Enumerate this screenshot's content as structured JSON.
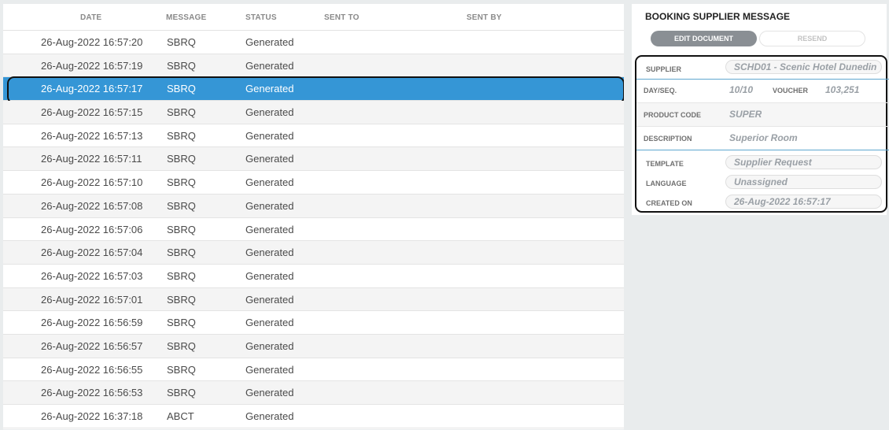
{
  "grid": {
    "headers": {
      "date": "DATE",
      "message": "MESSAGE",
      "status": "STATUS",
      "sent_to": "SENT TO",
      "sent_by": "SENT BY"
    },
    "rows": [
      {
        "date": "26-Aug-2022 16:57:20",
        "message": "SBRQ",
        "status": "Generated"
      },
      {
        "date": "26-Aug-2022 16:57:19",
        "message": "SBRQ",
        "status": "Generated"
      },
      {
        "date": "26-Aug-2022 16:57:17",
        "message": "SBRQ",
        "status": "Generated"
      },
      {
        "date": "26-Aug-2022 16:57:15",
        "message": "SBRQ",
        "status": "Generated"
      },
      {
        "date": "26-Aug-2022 16:57:13",
        "message": "SBRQ",
        "status": "Generated"
      },
      {
        "date": "26-Aug-2022 16:57:11",
        "message": "SBRQ",
        "status": "Generated"
      },
      {
        "date": "26-Aug-2022 16:57:10",
        "message": "SBRQ",
        "status": "Generated"
      },
      {
        "date": "26-Aug-2022 16:57:08",
        "message": "SBRQ",
        "status": "Generated"
      },
      {
        "date": "26-Aug-2022 16:57:06",
        "message": "SBRQ",
        "status": "Generated"
      },
      {
        "date": "26-Aug-2022 16:57:04",
        "message": "SBRQ",
        "status": "Generated"
      },
      {
        "date": "26-Aug-2022 16:57:03",
        "message": "SBRQ",
        "status": "Generated"
      },
      {
        "date": "26-Aug-2022 16:57:01",
        "message": "SBRQ",
        "status": "Generated"
      },
      {
        "date": "26-Aug-2022 16:56:59",
        "message": "SBRQ",
        "status": "Generated"
      },
      {
        "date": "26-Aug-2022 16:56:57",
        "message": "SBRQ",
        "status": "Generated"
      },
      {
        "date": "26-Aug-2022 16:56:55",
        "message": "SBRQ",
        "status": "Generated"
      },
      {
        "date": "26-Aug-2022 16:56:53",
        "message": "SBRQ",
        "status": "Generated"
      },
      {
        "date": "26-Aug-2022 16:37:18",
        "message": "ABCT",
        "status": "Generated"
      }
    ],
    "selected_row_index": 2
  },
  "detail": {
    "title": "BOOKING SUPPLIER MESSAGE",
    "edit_button": "EDIT DOCUMENT",
    "resend_button": "RESEND",
    "supplier_label": "SUPPLIER",
    "supplier_value": "SCHD01 - Scenic Hotel Dunedin",
    "dayseq_label": "DAY/SEQ.",
    "dayseq_value": "10/10",
    "voucher_label": "VOUCHER",
    "voucher_value": "103,251",
    "product_code_label": "PRODUCT CODE",
    "product_code_value": "SUPER",
    "description_label": "DESCRIPTION",
    "description_value": "Superior Room",
    "template_label": "TEMPLATE",
    "template_value": "Supplier Request",
    "language_label": "LANGUAGE",
    "language_value": "Unassigned",
    "created_on_label": "CREATED ON",
    "created_on_value": "26-Aug-2022 16:57:17"
  },
  "colors": {
    "selected_row": "#3596d6",
    "edit_button": "#8a8f94",
    "divider": "#5fa7cf"
  }
}
